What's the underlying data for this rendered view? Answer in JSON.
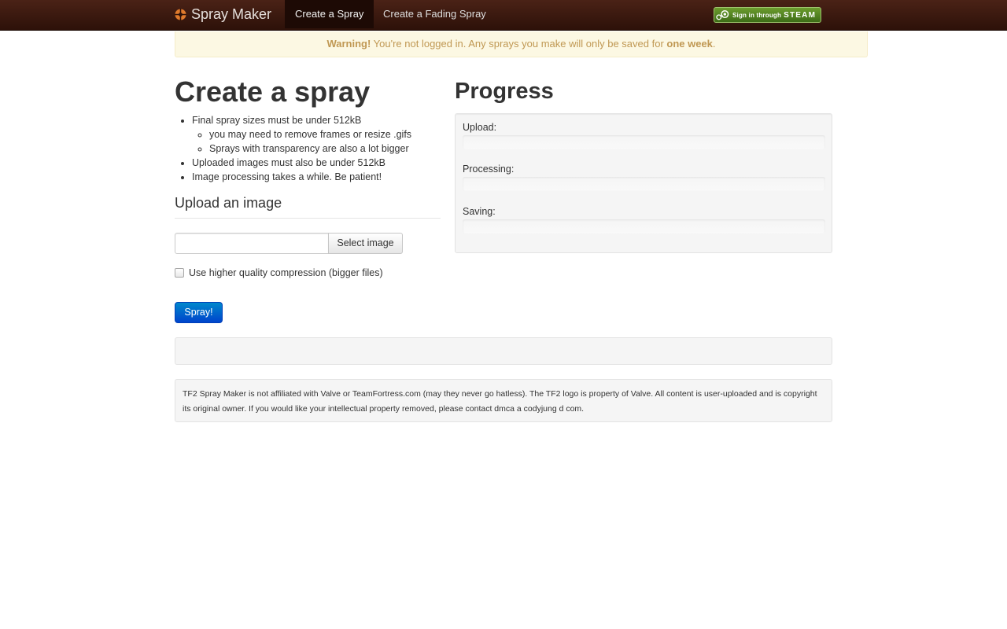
{
  "navbar": {
    "brand": "Spray Maker",
    "items": [
      {
        "label": "Create a Spray",
        "active": true
      },
      {
        "label": "Create a Fading Spray",
        "active": false
      }
    ],
    "steam": {
      "prefix": "Sign in through",
      "word": "STEAM"
    }
  },
  "alert": {
    "strong": "Warning!",
    "text": " You're not logged in. Any sprays you make will only be saved for ",
    "emph": "one week",
    "end": "."
  },
  "create": {
    "title": "Create a spray",
    "rules": [
      "Final spray sizes must be under 512kB",
      "you may need to remove frames or resize .gifs",
      "Sprays with transparency are also a lot bigger",
      "Uploaded images must also be under 512kB",
      "Image processing takes a while. Be patient!"
    ],
    "upload_heading": "Upload an image",
    "file_value": "",
    "select_label": "Select image",
    "checkbox_label": "Use higher quality compression (bigger files)",
    "checkbox_checked": false,
    "submit_label": "Spray!"
  },
  "progress": {
    "title": "Progress",
    "items": [
      {
        "label": "Upload:",
        "value": 0
      },
      {
        "label": "Processing:",
        "value": 0
      },
      {
        "label": "Saving:",
        "value": 0
      }
    ]
  },
  "footer": {
    "text": "TF2 Spray Maker is not affiliated with Valve or TeamFortress.com (may they never go hatless). The TF2 logo is property of Valve. All content is user-uploaded and is copyright its original owner. If you would like your intellectual property removed, please contact dmca a codyjung d com."
  },
  "colors": {
    "navbar": "#2d1109",
    "alert_text": "#c09853",
    "primary": "#0055cc",
    "steam_green": "#4f7f22"
  }
}
